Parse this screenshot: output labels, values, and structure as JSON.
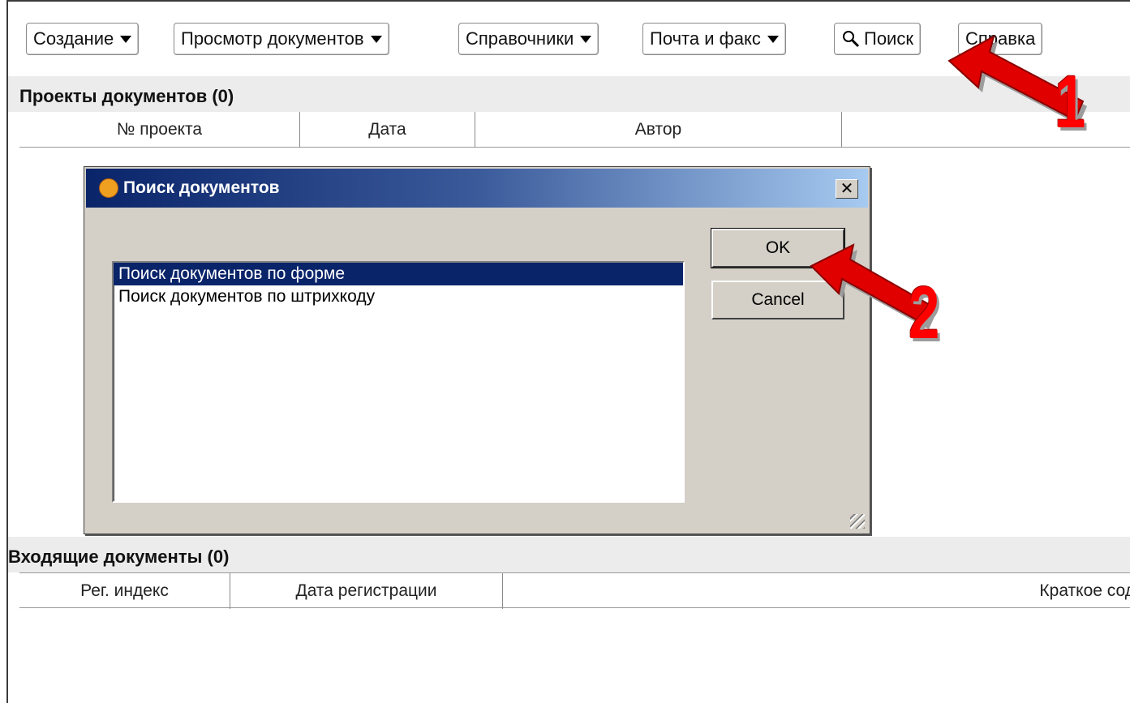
{
  "toolbar": {
    "buttons": [
      {
        "label": "Создание",
        "dropdown": true
      },
      {
        "label": "Просмотр документов",
        "dropdown": true
      },
      {
        "label": "Справочники",
        "dropdown": true
      },
      {
        "label": "Почта и факс",
        "dropdown": true
      },
      {
        "label": "Поиск",
        "icon": "magnifier-icon"
      },
      {
        "label": "Справка"
      }
    ]
  },
  "projects": {
    "title": "Проекты документов (0)",
    "columns": [
      "№ проекта",
      "Дата",
      "Автор"
    ]
  },
  "incoming": {
    "title": "Входящие документы (0)",
    "columns": [
      "Рег. индекс",
      "Дата регистрации",
      "Краткое сод"
    ]
  },
  "dialog": {
    "title": "Поиск документов",
    "close_label": "✕",
    "items": [
      "Поиск документов по форме",
      "Поиск документов по штрихкоду"
    ],
    "selected_index": 0,
    "ok_label": "OK",
    "cancel_label": "Cancel"
  },
  "annotations": {
    "step1": "1",
    "step2": "2"
  },
  "colors": {
    "arrow": "#e00000",
    "selection": "#0a246a",
    "dialog_face": "#d4d0c8"
  }
}
